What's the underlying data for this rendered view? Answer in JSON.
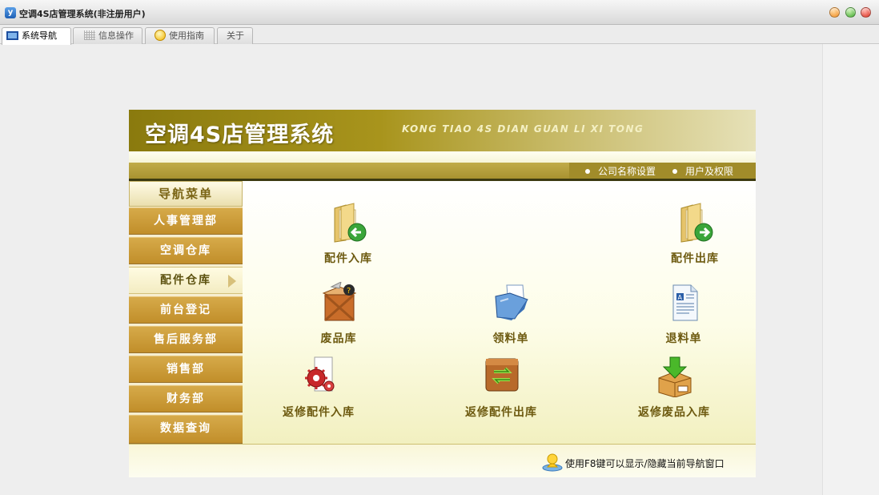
{
  "window": {
    "title": "空调4S店管理系统(非注册用户)",
    "app_icon_letter": "y"
  },
  "tabs": [
    {
      "label": "系统导航",
      "icon": "monitor-icon",
      "active": true
    },
    {
      "label": "信息操作",
      "icon": "grid-icon",
      "active": false
    },
    {
      "label": "使用指南",
      "icon": "guide-icon",
      "active": false
    },
    {
      "label": "关于",
      "icon": "",
      "active": false
    }
  ],
  "banner": {
    "title": "空调4S店管理系统",
    "subtitle": "KONG TIAO  4S DIAN GUAN LI XI TONG"
  },
  "links": {
    "company_settings": "公司名称设置",
    "user_permissions": "用户及权限"
  },
  "nav": {
    "header": "导航菜单",
    "items": [
      "人事管理部",
      "空调仓库",
      "配件仓库",
      "前台登记",
      "售后服务部",
      "销售部",
      "财务部",
      "数据查询"
    ],
    "active_index": 2
  },
  "content": {
    "items": [
      {
        "label": "配件入库",
        "icon": "folder-in-icon"
      },
      {
        "label": "配件出库",
        "icon": "folder-out-icon"
      },
      {
        "label": "废品库",
        "icon": "crate-icon"
      },
      {
        "label": "领料单",
        "icon": "open-folder-icon"
      },
      {
        "label": "退料单",
        "icon": "document-icon"
      },
      {
        "label": "返修配件入库",
        "icon": "gear-icon"
      },
      {
        "label": "返修配件出库",
        "icon": "recycle-box-icon"
      },
      {
        "label": "返修废品入库",
        "icon": "download-box-icon"
      }
    ]
  },
  "footer": {
    "hint": "使用F8键可以显示/隐藏当前导航窗口"
  },
  "colors": {
    "banner_dark": "#8a7a0e",
    "nav_item": "#c9982f",
    "label_text": "#6d5a10"
  }
}
